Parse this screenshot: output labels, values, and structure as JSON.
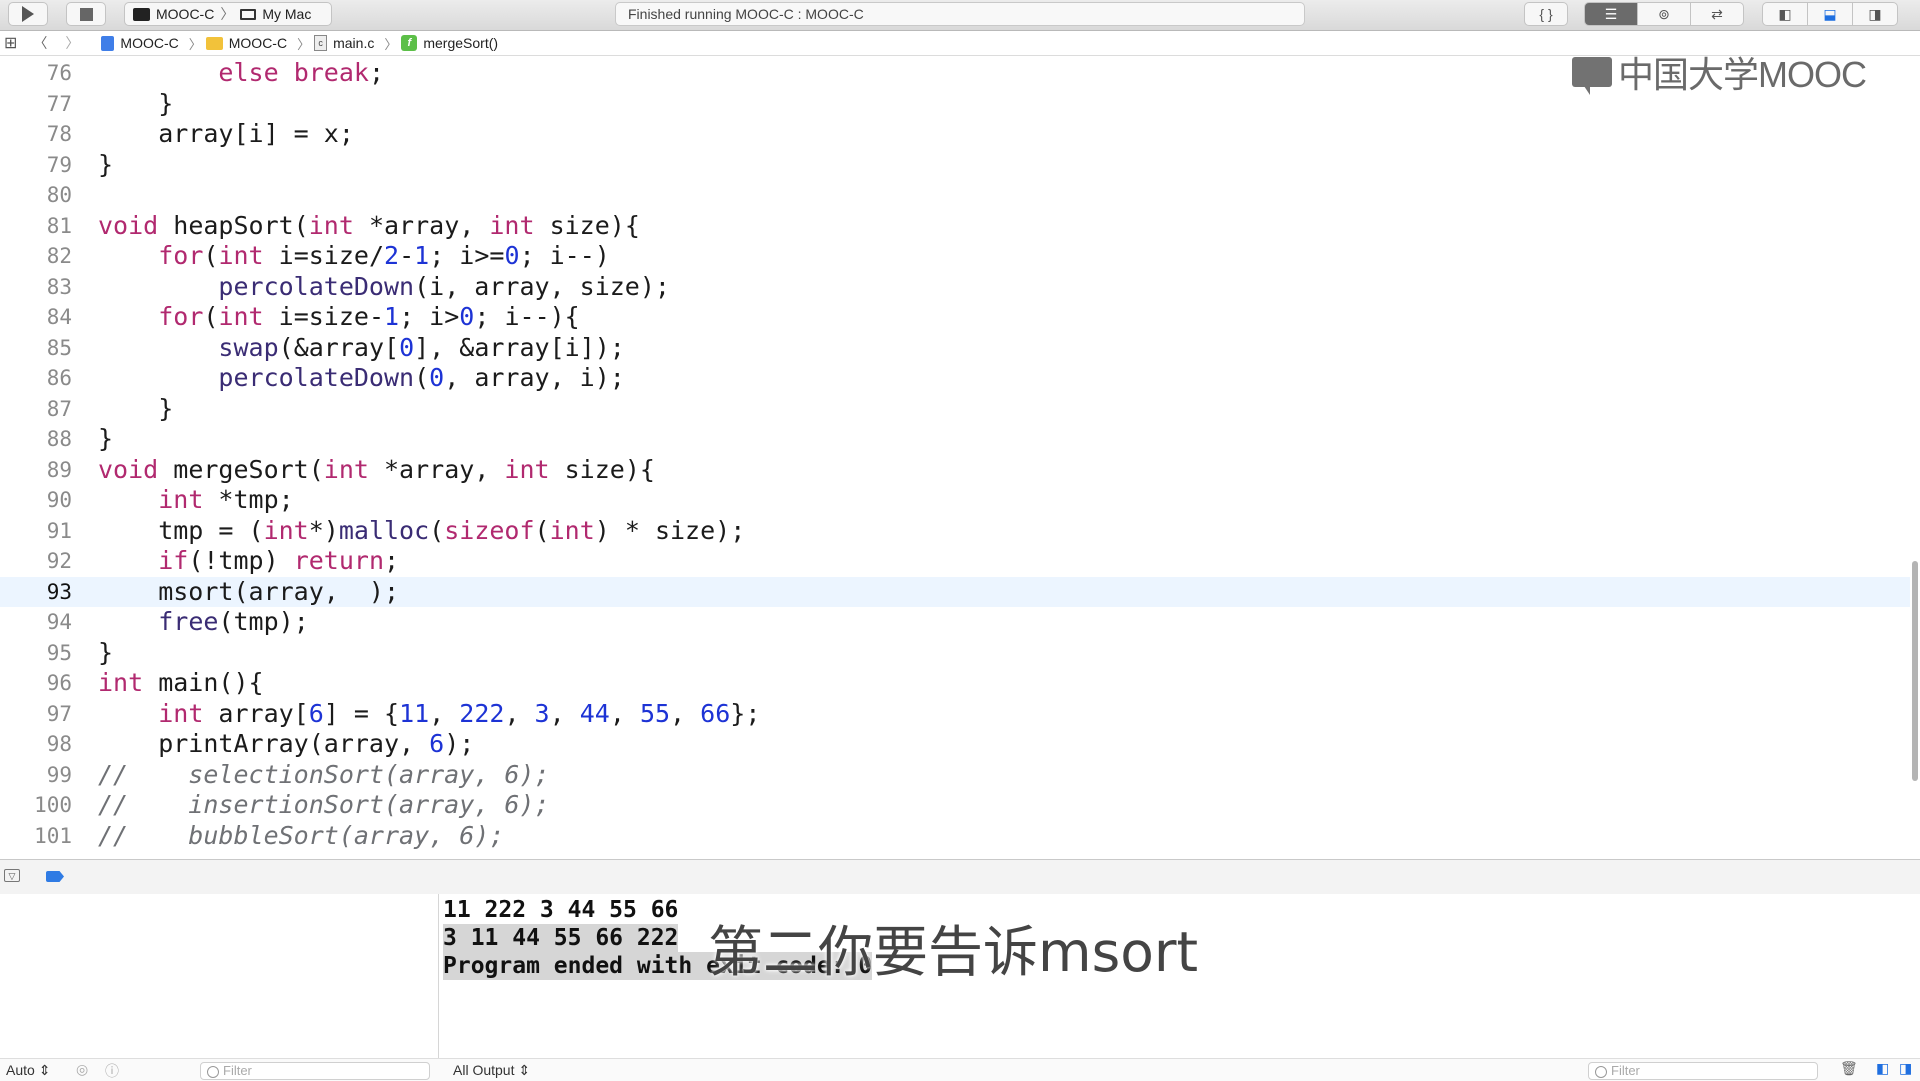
{
  "toolbar": {
    "scheme": "MOOC-C",
    "destination": "My Mac",
    "activity": "Finished running MOOC-C : MOOC-C",
    "braces_label": "{ }"
  },
  "jumpbar": {
    "project": "MOOC-C",
    "group": "MOOC-C",
    "file": "main.c",
    "symbol": "mergeSort()",
    "func_badge": "f",
    "file_badge": "c"
  },
  "watermark": {
    "text": "中国大学MOOC"
  },
  "code_lines": [
    {
      "num": "76",
      "parts": [
        [
          "",
          "        "
        ],
        [
          "k",
          "else"
        ],
        [
          "",
          " "
        ],
        [
          "k",
          "break"
        ],
        [
          "",
          ";"
        ]
      ]
    },
    {
      "num": "77",
      "parts": [
        [
          "",
          "    }"
        ]
      ]
    },
    {
      "num": "78",
      "parts": [
        [
          "",
          "    array[i] = x;"
        ]
      ]
    },
    {
      "num": "79",
      "parts": [
        [
          "",
          "}"
        ]
      ]
    },
    {
      "num": "80",
      "parts": []
    },
    {
      "num": "81",
      "parts": [
        [
          "k",
          "void"
        ],
        [
          "",
          " heapSort("
        ],
        [
          "k",
          "int"
        ],
        [
          "",
          " *array, "
        ],
        [
          "k",
          "int"
        ],
        [
          "",
          " size){"
        ]
      ]
    },
    {
      "num": "82",
      "parts": [
        [
          "",
          "    "
        ],
        [
          "k",
          "for"
        ],
        [
          "",
          "("
        ],
        [
          "k",
          "int"
        ],
        [
          "",
          " i=size/"
        ],
        [
          "n",
          "2"
        ],
        [
          "",
          "-"
        ],
        [
          "n",
          "1"
        ],
        [
          "",
          "; i>="
        ],
        [
          "n",
          "0"
        ],
        [
          "",
          "; i--)"
        ]
      ]
    },
    {
      "num": "83",
      "parts": [
        [
          "",
          "        "
        ],
        [
          "f",
          "percolateDown"
        ],
        [
          "",
          "(i, array, size);"
        ]
      ]
    },
    {
      "num": "84",
      "parts": [
        [
          "",
          "    "
        ],
        [
          "k",
          "for"
        ],
        [
          "",
          "("
        ],
        [
          "k",
          "int"
        ],
        [
          "",
          " i=size-"
        ],
        [
          "n",
          "1"
        ],
        [
          "",
          "; i>"
        ],
        [
          "n",
          "0"
        ],
        [
          "",
          "; i--){"
        ]
      ]
    },
    {
      "num": "85",
      "parts": [
        [
          "",
          "        "
        ],
        [
          "f",
          "swap"
        ],
        [
          "",
          "(&array["
        ],
        [
          "n",
          "0"
        ],
        [
          "",
          "], &array[i]);"
        ]
      ]
    },
    {
      "num": "86",
      "parts": [
        [
          "",
          "        "
        ],
        [
          "f",
          "percolateDown"
        ],
        [
          "",
          "("
        ],
        [
          "n",
          "0"
        ],
        [
          "",
          ", array, i);"
        ]
      ]
    },
    {
      "num": "87",
      "parts": [
        [
          "",
          "    }"
        ]
      ]
    },
    {
      "num": "88",
      "parts": [
        [
          "",
          "}"
        ]
      ]
    },
    {
      "num": "89",
      "parts": [
        [
          "k",
          "void"
        ],
        [
          "",
          " mergeSort("
        ],
        [
          "k",
          "int"
        ],
        [
          "",
          " *array, "
        ],
        [
          "k",
          "int"
        ],
        [
          "",
          " size){"
        ]
      ]
    },
    {
      "num": "90",
      "parts": [
        [
          "",
          "    "
        ],
        [
          "k",
          "int"
        ],
        [
          "",
          " *tmp;"
        ]
      ]
    },
    {
      "num": "91",
      "parts": [
        [
          "",
          "    tmp = ("
        ],
        [
          "k",
          "int"
        ],
        [
          "",
          "*)"
        ],
        [
          "f",
          "malloc"
        ],
        [
          "",
          "("
        ],
        [
          "k",
          "sizeof"
        ],
        [
          "",
          "("
        ],
        [
          "k",
          "int"
        ],
        [
          "",
          ") * size);"
        ]
      ]
    },
    {
      "num": "92",
      "parts": [
        [
          "",
          "    "
        ],
        [
          "k",
          "if"
        ],
        [
          "",
          "(!tmp) "
        ],
        [
          "k",
          "return"
        ],
        [
          "",
          ";"
        ]
      ]
    },
    {
      "num": "93",
      "current": true,
      "parts": [
        [
          "",
          "    msort(array,  );"
        ]
      ]
    },
    {
      "num": "94",
      "parts": [
        [
          "",
          "    "
        ],
        [
          "f",
          "free"
        ],
        [
          "",
          "(tmp);"
        ]
      ]
    },
    {
      "num": "95",
      "parts": [
        [
          "",
          "}"
        ]
      ]
    },
    {
      "num": "96",
      "parts": [
        [
          "k",
          "int"
        ],
        [
          "",
          " main(){"
        ]
      ]
    },
    {
      "num": "97",
      "parts": [
        [
          "",
          "    "
        ],
        [
          "k",
          "int"
        ],
        [
          "",
          " array["
        ],
        [
          "n",
          "6"
        ],
        [
          "",
          "] = {"
        ],
        [
          "n",
          "11"
        ],
        [
          "",
          ", "
        ],
        [
          "n",
          "222"
        ],
        [
          "",
          ", "
        ],
        [
          "n",
          "3"
        ],
        [
          "",
          ", "
        ],
        [
          "n",
          "44"
        ],
        [
          "",
          ", "
        ],
        [
          "n",
          "55"
        ],
        [
          "",
          ", "
        ],
        [
          "n",
          "66"
        ],
        [
          "",
          "};"
        ]
      ]
    },
    {
      "num": "98",
      "parts": [
        [
          "",
          "    printArray(array, "
        ],
        [
          "n",
          "6"
        ],
        [
          "",
          ");"
        ]
      ]
    },
    {
      "num": "99",
      "parts": [
        [
          "c",
          "//    selectionSort(array, 6);"
        ]
      ]
    },
    {
      "num": "100",
      "parts": [
        [
          "c",
          "//    insertionSort(array, 6);"
        ]
      ]
    },
    {
      "num": "101",
      "parts": [
        [
          "c",
          "//    bubbleSort(array, 6);"
        ]
      ]
    }
  ],
  "console": {
    "lines": [
      "11 222 3 44 55 66",
      "3 11 44 55 66 222",
      "Program ended with exit code: 0"
    ]
  },
  "subtitle": "第二你要告诉msort",
  "bottom_bar": {
    "auto_label": "Auto ⇕",
    "filter_placeholder": "Filter",
    "output_label": "All Output ⇕",
    "right_filter_placeholder": "Filter"
  }
}
